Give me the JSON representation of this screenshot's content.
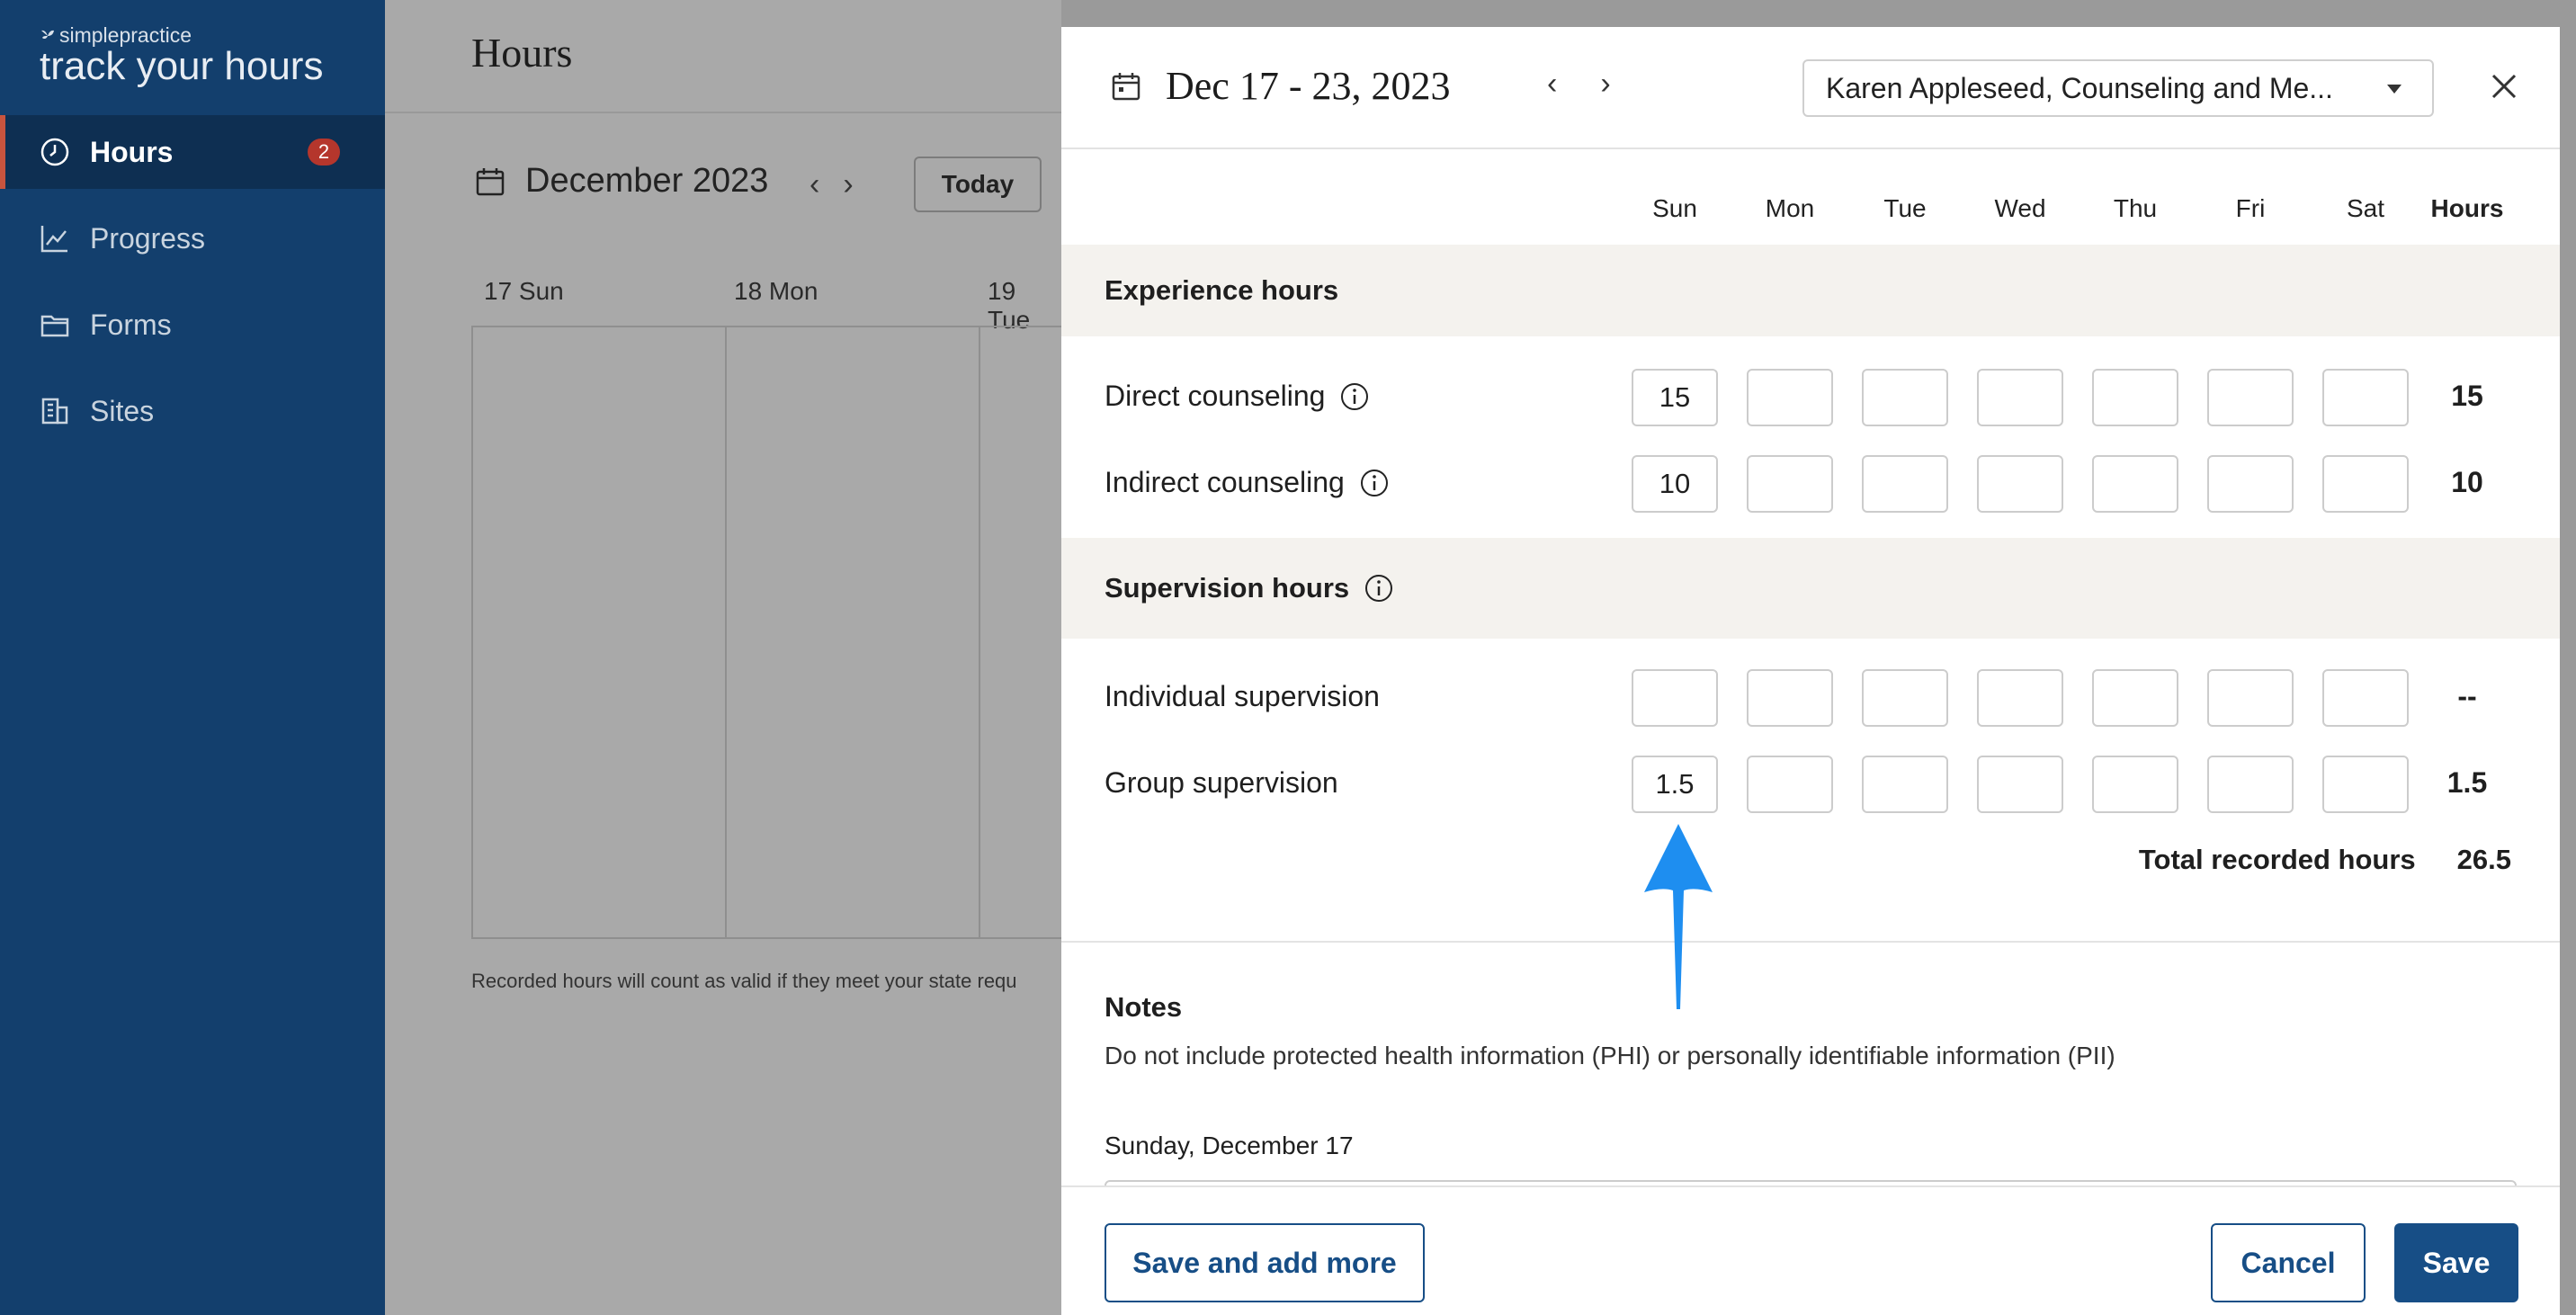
{
  "sidebar": {
    "brand": "simplepractice",
    "product": "track your hours",
    "items": [
      {
        "label": "Hours",
        "badge": "2"
      },
      {
        "label": "Progress"
      },
      {
        "label": "Forms"
      },
      {
        "label": "Sites"
      }
    ]
  },
  "background": {
    "title": "Hours",
    "month": "December 2023",
    "today": "Today",
    "days": [
      "17  Sun",
      "18  Mon",
      "19  Tue"
    ],
    "footer": "Recorded hours will count as valid if they meet your state requ"
  },
  "modal": {
    "date_range": "Dec 17 - 23, 2023",
    "site_select": "Karen Appleseed, Counseling and Me...",
    "weekdays": [
      "Sun",
      "Mon",
      "Tue",
      "Wed",
      "Thu",
      "Fri",
      "Sat"
    ],
    "hours_header": "Hours",
    "experience": {
      "title": "Experience hours",
      "rows": [
        {
          "label": "Direct counseling",
          "values": [
            "15",
            "",
            "",
            "",
            "",
            "",
            ""
          ],
          "total": "15"
        },
        {
          "label": "Indirect counseling",
          "values": [
            "10",
            "",
            "",
            "",
            "",
            "",
            ""
          ],
          "total": "10"
        }
      ]
    },
    "supervision": {
      "title": "Supervision hours",
      "rows": [
        {
          "label": "Individual supervision",
          "values": [
            "",
            "",
            "",
            "",
            "",
            "",
            ""
          ],
          "total": "--"
        },
        {
          "label": "Group supervision",
          "values": [
            "1.5",
            "",
            "",
            "",
            "",
            "",
            ""
          ],
          "total": "1.5"
        }
      ]
    },
    "total_label": "Total recorded hours",
    "total_value": "26.5",
    "notes": {
      "title": "Notes",
      "hint": "Do not include protected health information (PHI) or personally identifiable information (PII)",
      "day_label": "Sunday, December 17"
    },
    "buttons": {
      "save_add": "Save and add more",
      "cancel": "Cancel",
      "save": "Save"
    }
  },
  "colors": {
    "sidebar": "#133f6d",
    "primary": "#174e86",
    "badge": "#b5362c",
    "arrow": "#1e8ef0"
  }
}
